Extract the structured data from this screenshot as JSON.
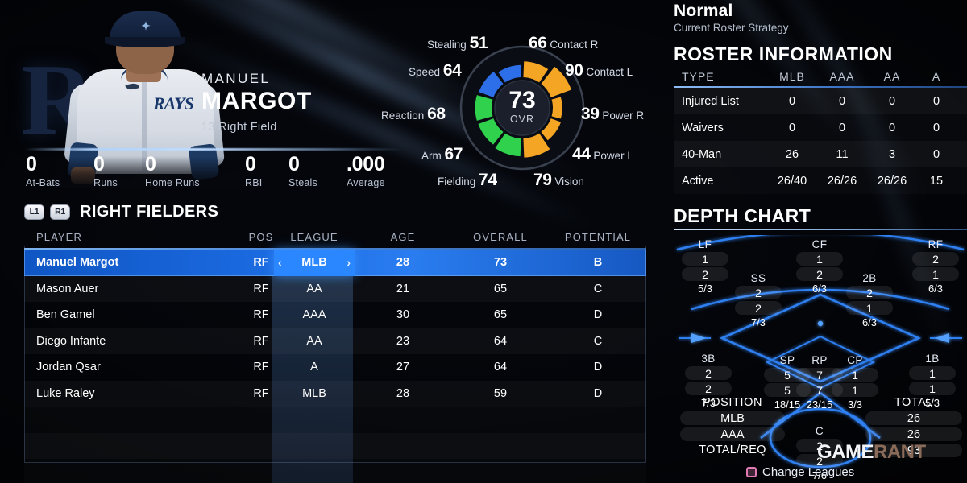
{
  "player": {
    "team_logo_letter": "R",
    "jersey_text": "RAYS",
    "first_name": "MANUEL",
    "last_name": "MARGOT",
    "number": "13",
    "position_name": "Right Field",
    "meta_line": "13  Right Field",
    "stats": [
      {
        "value": "0",
        "label": "At-Bats"
      },
      {
        "value": "0",
        "label": "Runs"
      },
      {
        "value": "0",
        "label": "Home Runs"
      },
      {
        "value": "0",
        "label": "RBI"
      },
      {
        "value": "0",
        "label": "Steals"
      },
      {
        "value": ".000",
        "label": "Average"
      }
    ]
  },
  "attributes": {
    "overall_value": "73",
    "overall_label": "OVR",
    "colors": {
      "orange": "#f5a524",
      "green": "#2fd14d",
      "blue": "#2d6fe8"
    },
    "items": [
      {
        "label": "Stealing",
        "value": "51",
        "color": "blue",
        "side": "left"
      },
      {
        "label": "Speed",
        "value": "64",
        "color": "blue",
        "side": "left"
      },
      {
        "label": "Reaction",
        "value": "68",
        "color": "green",
        "side": "left"
      },
      {
        "label": "Arm",
        "value": "67",
        "color": "green",
        "side": "left"
      },
      {
        "label": "Fielding",
        "value": "74",
        "color": "green",
        "side": "left"
      },
      {
        "label": "Contact R",
        "value": "66",
        "color": "orange",
        "side": "right"
      },
      {
        "label": "Contact L",
        "value": "90",
        "color": "orange",
        "side": "right"
      },
      {
        "label": "Power R",
        "value": "39",
        "color": "orange",
        "side": "right"
      },
      {
        "label": "Power L",
        "value": "44",
        "color": "orange",
        "side": "right"
      },
      {
        "label": "Vision",
        "value": "79",
        "color": "orange",
        "side": "right"
      }
    ]
  },
  "roster_table": {
    "shoulder_left": "L1",
    "shoulder_right": "R1",
    "title": "RIGHT FIELDERS",
    "columns": [
      "PLAYER",
      "POS",
      "LEAGUE",
      "AGE",
      "OVERALL",
      "POTENTIAL"
    ],
    "chevron_left": "‹",
    "chevron_right": "›",
    "rows": [
      {
        "player": "Manuel Margot",
        "pos": "RF",
        "league": "MLB",
        "age": "28",
        "overall": "73",
        "potential": "B",
        "selected": true
      },
      {
        "player": "Mason Auer",
        "pos": "RF",
        "league": "AA",
        "age": "21",
        "overall": "65",
        "potential": "C",
        "selected": false
      },
      {
        "player": "Ben Gamel",
        "pos": "RF",
        "league": "AAA",
        "age": "30",
        "overall": "65",
        "potential": "D",
        "selected": false
      },
      {
        "player": "Diego Infante",
        "pos": "RF",
        "league": "AA",
        "age": "23",
        "overall": "64",
        "potential": "C",
        "selected": false
      },
      {
        "player": "Jordan Qsar",
        "pos": "RF",
        "league": "A",
        "age": "27",
        "overall": "64",
        "potential": "D",
        "selected": false
      },
      {
        "player": "Luke Raley",
        "pos": "RF",
        "league": "MLB",
        "age": "28",
        "overall": "59",
        "potential": "D",
        "selected": false
      }
    ],
    "empty_rows": 3
  },
  "strategy": {
    "name": "Normal",
    "subtitle": "Current Roster Strategy"
  },
  "roster_information": {
    "title": "ROSTER INFORMATION",
    "columns": [
      "TYPE",
      "MLB",
      "AAA",
      "AA",
      "A"
    ],
    "rows": [
      {
        "type": "Injured List",
        "mlb": "0",
        "aaa": "0",
        "aa": "0",
        "a": "0"
      },
      {
        "type": "Waivers",
        "mlb": "0",
        "aaa": "0",
        "aa": "0",
        "a": "0"
      },
      {
        "type": "40-Man",
        "mlb": "26",
        "aaa": "11",
        "aa": "3",
        "a": "0"
      },
      {
        "type": "Active",
        "mlb": "26/40",
        "aaa": "26/26",
        "aa": "26/26",
        "a": "15"
      }
    ]
  },
  "depth_chart": {
    "title": "DEPTH CHART",
    "positions": [
      {
        "name": "LF",
        "mlb": "1",
        "aaa": "2",
        "req": "5/3"
      },
      {
        "name": "CF",
        "mlb": "1",
        "aaa": "2",
        "req": "6/3"
      },
      {
        "name": "RF",
        "mlb": "2",
        "aaa": "1",
        "req": "6/3"
      },
      {
        "name": "SS",
        "mlb": "2",
        "aaa": "2",
        "req": "7/3"
      },
      {
        "name": "2B",
        "mlb": "2",
        "aaa": "1",
        "req": "6/3"
      },
      {
        "name": "3B",
        "mlb": "2",
        "aaa": "2",
        "req": "7/3"
      },
      {
        "name": "1B",
        "mlb": "1",
        "aaa": "1",
        "req": "5/3"
      },
      {
        "name": "SP",
        "mlb": "5",
        "aaa": "5",
        "req": "18/15"
      },
      {
        "name": "RP",
        "mlb": "7",
        "aaa": "7",
        "req": "23/15"
      },
      {
        "name": "CP",
        "mlb": "1",
        "aaa": "1",
        "req": "3/3"
      },
      {
        "name": "C",
        "mlb": "2",
        "aaa": "2",
        "req": "7/6"
      }
    ],
    "legend": {
      "position_label": "POSITION",
      "mlb_label": "MLB",
      "aaa_label": "AAA",
      "total_req_label": "TOTAL/REQ"
    },
    "totals": {
      "label": "TOTAL",
      "mlb": "26",
      "aaa": "26",
      "total_req": "93"
    }
  },
  "footer": {
    "change_leagues": "Change Leagues",
    "button_icon": "square-icon",
    "watermark_part1": "GAME",
    "watermark_part2": "RANT"
  }
}
